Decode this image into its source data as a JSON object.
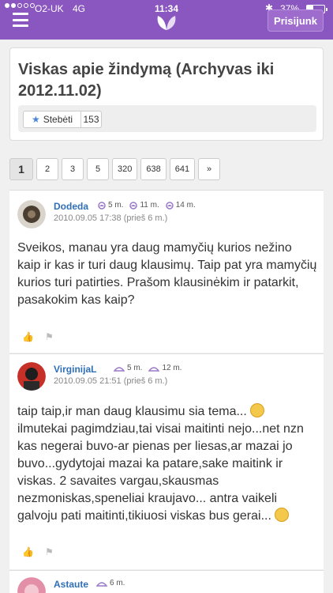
{
  "status": {
    "carrier": "O2-UK",
    "network": "4G",
    "time": "11:34",
    "battery": "37%",
    "battery_level": 0.37
  },
  "header": {
    "login": "Prisijunk"
  },
  "thread": {
    "title": "Viskas apie žindymą (Archyvas iki 2012.11.02)",
    "follow_label": "Stebėti",
    "follow_count": "153"
  },
  "pagination": [
    "1",
    "2",
    "3",
    "5",
    "320",
    "638",
    "641",
    "»"
  ],
  "posts": [
    {
      "user": "Dodeda",
      "badges": [
        "5 m.",
        "11 m.",
        "14 m."
      ],
      "date": "2010.09.05 17:38 (prieš 6 m.)",
      "text": "Sveikos, manau yra daug mamyčių kurios nežino kaip ir kas ir turi daug klausimų. Taip pat yra mamyčių kurios turi patirties. Prašom klausinėkim ir patarkit, pasakokim kas kaip?"
    },
    {
      "user": "VirginijaL",
      "badges": [
        "5 m.",
        "12 m."
      ],
      "date": "2010.09.05 21:51 (prieš 6 m.)",
      "text_a": "taip taip,ir man daug klausimu sia tema...",
      "text_b": "ilmutekai pagimdziau,tai visai maitinti nejo...net nzn kas negerai buvo-ar pienas per liesas,ar mazai jo buvo...gydytojai mazai ka patare,sake maitink ir viskas. 2 savaites vargau,skausmas nezmoniskas,speneliai kraujavo... antra vaikeli galvoju pati maitinti,tikiuosi viskas bus gerai..."
    },
    {
      "user": "Astaute",
      "badges": [
        "6 m."
      ]
    }
  ]
}
